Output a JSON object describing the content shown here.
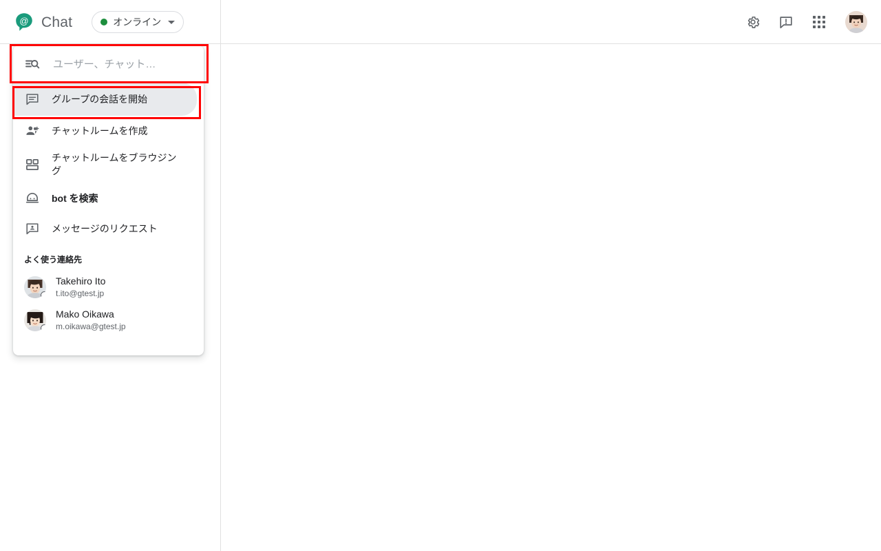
{
  "header": {
    "brand_name": "Chat",
    "logo_icon": "chat-at-bubble-icon",
    "logo_color": "#1a9b7c",
    "status": {
      "label": "オンライン",
      "dot_color": "#1e8e3e",
      "caret_icon": "chevron-down-icon"
    },
    "actions": [
      {
        "name": "settings-button",
        "icon": "gear-icon"
      },
      {
        "name": "feedback-button",
        "icon": "feedback-bubble-icon"
      },
      {
        "name": "apps-button",
        "icon": "apps-grid-icon"
      }
    ],
    "avatar": {
      "name": "user-avatar",
      "icon": "avatar-icon"
    }
  },
  "roster": {
    "search": {
      "placeholder": "ユーザー、チャット…",
      "value": "",
      "icon": "search-filter-icon"
    },
    "menu_items": [
      {
        "id": "group-chat",
        "label": "グループの会話を開始",
        "icon": "chat-bubble-lines-icon",
        "selected": true
      },
      {
        "id": "create-room",
        "label": "チャットルームを作成",
        "icon": "person-add-icon",
        "selected": false
      },
      {
        "id": "browse-rooms",
        "label": "チャットルームをブラウジング",
        "icon": "rooms-grid-icon",
        "selected": false
      },
      {
        "id": "find-bot",
        "label": "bot を検索",
        "icon": "bot-head-icon",
        "selected": false
      },
      {
        "id": "message-requests",
        "label": "メッセージのリクエスト",
        "icon": "message-person-icon",
        "selected": false
      }
    ],
    "section_title": "よく使う連絡先",
    "contacts": [
      {
        "name": "Takehiro Ito",
        "email": "t.ito@gtest.jp",
        "avatar": "avatar-takehiro-ito"
      },
      {
        "name": "Mako Oikawa",
        "email": "m.oikawa@gtest.jp",
        "avatar": "avatar-mako-oikawa"
      }
    ]
  },
  "annotations": {
    "highlight_color": "#ff0000",
    "boxes": [
      {
        "name": "search-field-highlight"
      },
      {
        "name": "group-chat-item-highlight"
      }
    ]
  }
}
